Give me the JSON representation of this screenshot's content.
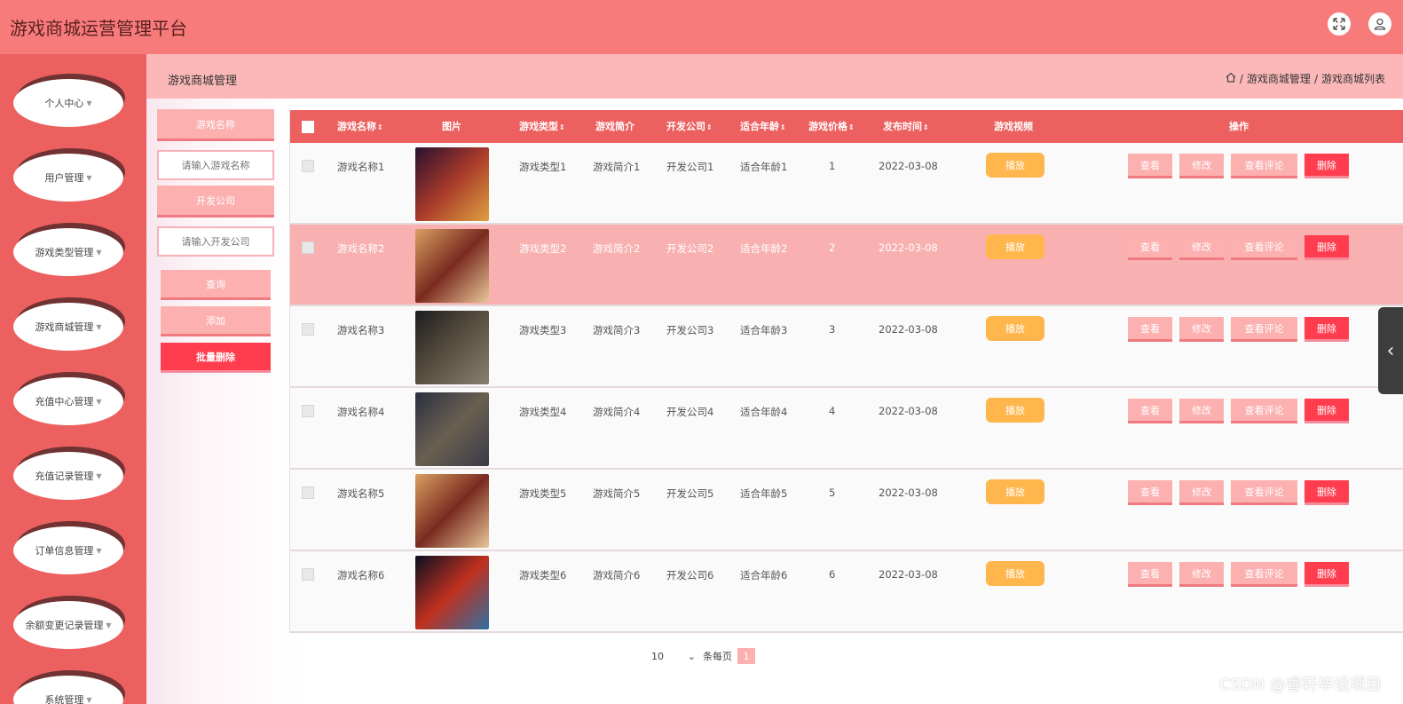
{
  "app": {
    "title": "游戏商城运营管理平台"
  },
  "sidebar": {
    "items": [
      {
        "label": "个人中心"
      },
      {
        "label": "用户管理"
      },
      {
        "label": "游戏类型管理"
      },
      {
        "label": "游戏商城管理"
      },
      {
        "label": "充值中心管理"
      },
      {
        "label": "充值记录管理"
      },
      {
        "label": "订单信息管理"
      },
      {
        "label": "余额变更记录管理"
      },
      {
        "label": "系统管理"
      }
    ]
  },
  "breadcrumb": {
    "title": "游戏商城管理",
    "path1": "游戏商城管理",
    "path2": "游戏商城列表",
    "sep": "/"
  },
  "search": {
    "name_label": "游戏名称",
    "name_placeholder": "请输入游戏名称",
    "company_label": "开发公司",
    "company_placeholder": "请输入开发公司",
    "query_btn": "查询",
    "add_btn": "添加",
    "batch_delete_btn": "批量删除"
  },
  "table": {
    "headers": [
      "游戏名称",
      "图片",
      "游戏类型",
      "游戏简介",
      "开发公司",
      "适合年龄",
      "游戏价格",
      "发布时间",
      "游戏视频",
      "操作"
    ],
    "sort_glyph": "⇕",
    "play_label": "播放",
    "actions": [
      "查看",
      "修改",
      "查看评论",
      "删除"
    ],
    "rows": [
      {
        "name": "游戏名称1",
        "type": "游戏类型1",
        "intro": "游戏简介1",
        "company": "开发公司1",
        "age": "适合年龄1",
        "price": "1",
        "date": "2022-03-08"
      },
      {
        "name": "游戏名称2",
        "type": "游戏类型2",
        "intro": "游戏简介2",
        "company": "开发公司2",
        "age": "适合年龄2",
        "price": "2",
        "date": "2022-03-08"
      },
      {
        "name": "游戏名称3",
        "type": "游戏类型3",
        "intro": "游戏简介3",
        "company": "开发公司3",
        "age": "适合年龄3",
        "price": "3",
        "date": "2022-03-08"
      },
      {
        "name": "游戏名称4",
        "type": "游戏类型4",
        "intro": "游戏简介4",
        "company": "开发公司4",
        "age": "适合年龄4",
        "price": "4",
        "date": "2022-03-08"
      },
      {
        "name": "游戏名称5",
        "type": "游戏类型5",
        "intro": "游戏简介5",
        "company": "开发公司5",
        "age": "适合年龄5",
        "price": "5",
        "date": "2022-03-08"
      },
      {
        "name": "游戏名称6",
        "type": "游戏类型6",
        "intro": "游戏简介6",
        "company": "开发公司6",
        "age": "适合年龄6",
        "price": "6",
        "date": "2022-03-08"
      }
    ]
  },
  "pagination": {
    "page_size": "10",
    "per_page_label": "条每页",
    "current_page": "1"
  },
  "watermark": "CSDN @睿轩毕设项目",
  "colors": {
    "topbar": "#f77b7b",
    "sidebar": "#ec6060",
    "header": "#ec6060",
    "accent": "#fcb0b0",
    "danger": "#ff3d4f",
    "play": "#ffb64d"
  },
  "icons": [
    "fullscreen-icon",
    "user-icon",
    "home-icon",
    "chevron-left-icon"
  ]
}
